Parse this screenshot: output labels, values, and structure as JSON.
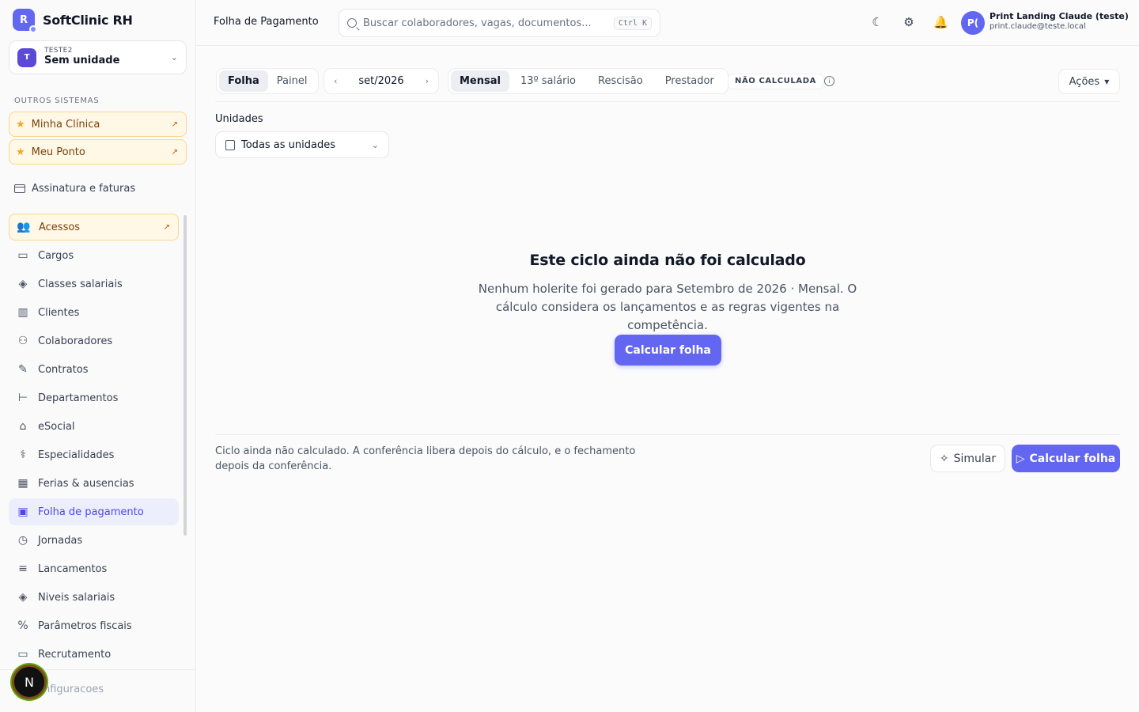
{
  "brand": {
    "logo_letter": "R",
    "name": "SoftClinic RH",
    "color": "#6366f1"
  },
  "tenant": {
    "avatar": "T",
    "code": "TESTE2",
    "unit": "Sem unidade"
  },
  "sidebar": {
    "section_label": "OUTROS SISTEMAS",
    "external": [
      {
        "label": "Minha Clínica",
        "icon": "star-icon"
      },
      {
        "label": "Meu Ponto",
        "icon": "star-icon"
      }
    ],
    "billing": "Assinatura e faturas",
    "items": [
      {
        "label": "Acessos",
        "icon": "users-star-icon",
        "featured": true
      },
      {
        "label": "Cargos",
        "icon": "briefcase-icon"
      },
      {
        "label": "Classes salariais",
        "icon": "layers-icon"
      },
      {
        "label": "Clientes",
        "icon": "building-icon"
      },
      {
        "label": "Colaboradores",
        "icon": "users-icon"
      },
      {
        "label": "Contratos",
        "icon": "file-edit-icon"
      },
      {
        "label": "Departamentos",
        "icon": "hierarchy-icon"
      },
      {
        "label": "eSocial",
        "icon": "bank-icon"
      },
      {
        "label": "Especialidades",
        "icon": "stethoscope-icon"
      },
      {
        "label": "Ferias & ausencias",
        "icon": "calendar-icon"
      },
      {
        "label": "Folha de pagamento",
        "icon": "wallet-icon",
        "active": true
      },
      {
        "label": "Jornadas",
        "icon": "calendar-clock-icon"
      },
      {
        "label": "Lancamentos",
        "icon": "list-plus-icon"
      },
      {
        "label": "Niveis salariais",
        "icon": "layers-icon"
      },
      {
        "label": "Parâmetros fiscais",
        "icon": "percent-icon"
      },
      {
        "label": "Recrutamento",
        "icon": "briefcase-icon"
      }
    ],
    "bottom_item": "onfiguracoes",
    "floating_badge": "N"
  },
  "header": {
    "title": "Folha de Pagamento",
    "search_placeholder": "Buscar colaboradores, vagas, documentos...",
    "search_shortcut": "Ctrl K",
    "user_initials": "P(",
    "user_name": "Print Landing Claude (teste)",
    "user_email": "print.claude@teste.local"
  },
  "toolbar": {
    "view_tabs": [
      "Folha",
      "Painel"
    ],
    "view_selected": "Folha",
    "period": "set/2026",
    "type_tabs": [
      "Mensal",
      "13º salário",
      "Rescisão",
      "Prestador"
    ],
    "type_selected": "Mensal",
    "status": "NÃO CALCULADA",
    "actions_label": "Ações"
  },
  "filters": {
    "units_label": "Unidades",
    "units_value": "Todas as unidades"
  },
  "empty_state": {
    "title": "Este ciclo ainda não foi calculado",
    "description": "Nenhum holerite foi gerado para Setembro de 2026 · Mensal. O cálculo considera os lançamentos e as regras vigentes na competência.",
    "button": "Calcular folha"
  },
  "footer": {
    "note": "Ciclo ainda não calculado. A conferência libera depois do cálculo, e o fechamento depois da conferência.",
    "simulate": "Simular",
    "calculate": "Calcular folha"
  }
}
